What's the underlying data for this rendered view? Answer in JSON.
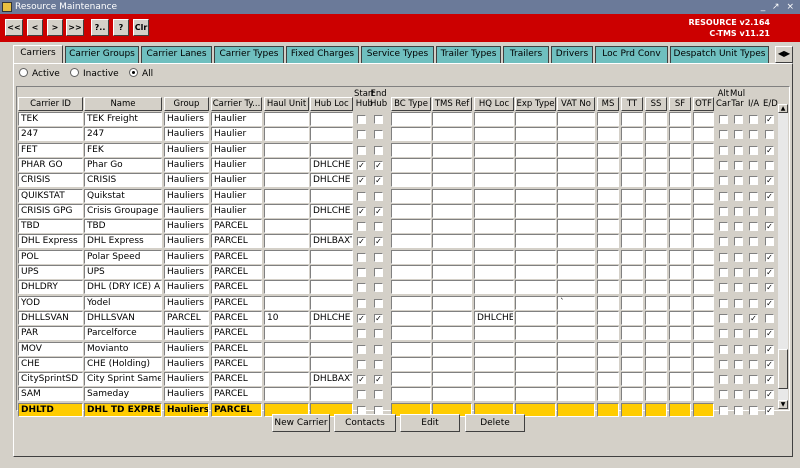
{
  "window": {
    "title": "Resource Maintenance",
    "controls": "_ ↗ ×"
  },
  "toolbar": {
    "buttons": [
      "<<",
      "<",
      ">",
      ">>",
      "?..",
      "?",
      "Clr"
    ]
  },
  "version": {
    "line1": "RESOURCE v2.164",
    "line2": "C-TMS v11.21"
  },
  "tabs": [
    "Carriers",
    "Carrier Groups",
    "Carrier Lanes",
    "Carrier Types",
    "Fixed Charges",
    "Service Types",
    "Trailer Types",
    "Trailers",
    "Drivers",
    "Loc Prd Conv",
    "Despatch Unit Types"
  ],
  "tab_scroll": "◀▶",
  "filter": {
    "options": [
      "Active",
      "Inactive",
      "All"
    ],
    "selected": "All"
  },
  "columns": {
    "carrier_id": "Carrier ID",
    "name": "Name",
    "group": "Group",
    "carrier_type": "Carrier Ty...",
    "haul_unit": "Haul Unit",
    "hub_loc": "Hub Loc",
    "start_hub": "Start\nHub",
    "end_hub": "End\nHub",
    "bc_type": "BC Type",
    "tms_ref": "TMS Ref",
    "hq_loc": "HQ Loc",
    "exp_type": "Exp Type",
    "vat_no": "VAT No",
    "ms": "MS",
    "tt": "TT",
    "ss": "SS",
    "sf": "SF",
    "otf": "OTF",
    "alt_car": "Alt\nCar",
    "mul_tar": "Mul\nTar",
    "ia": "I/A",
    "ed": "E/D"
  },
  "rows": [
    {
      "id": "TEK",
      "name": "TEK Freight",
      "group": "Hauliers",
      "type": "Haulier",
      "haul": "",
      "hub": "",
      "sh": false,
      "eh": false,
      "hq": "",
      "vat": "",
      "ed": true
    },
    {
      "id": "247",
      "name": "247",
      "group": "Hauliers",
      "type": "Haulier",
      "haul": "",
      "hub": "",
      "sh": false,
      "eh": false,
      "hq": "",
      "vat": "",
      "ed": false
    },
    {
      "id": "FET",
      "name": "FEK",
      "group": "Hauliers",
      "type": "Haulier",
      "haul": "",
      "hub": "",
      "sh": false,
      "eh": false,
      "hq": "",
      "vat": "",
      "ed": true
    },
    {
      "id": "PHAR GO",
      "name": "Phar Go",
      "group": "Hauliers",
      "type": "Haulier",
      "haul": "",
      "hub": "DHLCHE",
      "sh": true,
      "eh": true,
      "hq": "",
      "vat": "",
      "ed": false
    },
    {
      "id": "CRISIS",
      "name": "CRISIS",
      "group": "Hauliers",
      "type": "Haulier",
      "haul": "",
      "hub": "DHLCHE",
      "sh": true,
      "eh": true,
      "hq": "",
      "vat": "",
      "ed": true
    },
    {
      "id": "QUIKSTAT",
      "name": "Quikstat",
      "group": "Hauliers",
      "type": "Haulier",
      "haul": "",
      "hub": "",
      "sh": false,
      "eh": false,
      "hq": "",
      "vat": "",
      "ed": true
    },
    {
      "id": "CRISIS GPG",
      "name": "Crisis Groupage",
      "group": "Hauliers",
      "type": "Haulier",
      "haul": "",
      "hub": "DHLCHE",
      "sh": true,
      "eh": true,
      "hq": "",
      "vat": "",
      "ed": false
    },
    {
      "id": "TBD",
      "name": "TBD",
      "group": "Hauliers",
      "type": "PARCEL",
      "haul": "",
      "hub": "",
      "sh": false,
      "eh": false,
      "hq": "",
      "vat": "",
      "ed": true
    },
    {
      "id": "DHL Express",
      "name": "DHL Express",
      "group": "Hauliers",
      "type": "PARCEL",
      "haul": "",
      "hub": "DHLBAXT",
      "sh": true,
      "eh": true,
      "hq": "",
      "vat": "",
      "ed": false
    },
    {
      "id": "POL",
      "name": "Polar Speed",
      "group": "Hauliers",
      "type": "PARCEL",
      "haul": "",
      "hub": "",
      "sh": false,
      "eh": false,
      "hq": "",
      "vat": "",
      "ed": true
    },
    {
      "id": "UPS",
      "name": "UPS",
      "group": "Hauliers",
      "type": "PARCEL",
      "haul": "",
      "hub": "",
      "sh": false,
      "eh": false,
      "hq": "",
      "vat": "",
      "ed": true
    },
    {
      "id": "DHLDRY",
      "name": "DHL (DRY ICE) A",
      "group": "Hauliers",
      "type": "PARCEL",
      "haul": "",
      "hub": "",
      "sh": false,
      "eh": false,
      "hq": "",
      "vat": "",
      "ed": true
    },
    {
      "id": "YOD",
      "name": "Yodel",
      "group": "Hauliers",
      "type": "PARCEL",
      "haul": "",
      "hub": "",
      "sh": false,
      "eh": false,
      "hq": "",
      "vat": "`",
      "ed": true
    },
    {
      "id": "DHLLSVAN",
      "name": "DHLLSVAN",
      "group": "PARCEL",
      "type": "PARCEL",
      "haul": "10",
      "hub": "DHLCHE",
      "sh": true,
      "eh": true,
      "hq": "DHLCHE",
      "vat": "",
      "ed": false,
      "ia": true
    },
    {
      "id": "PAR",
      "name": "Parcelforce",
      "group": "Hauliers",
      "type": "PARCEL",
      "haul": "",
      "hub": "",
      "sh": false,
      "eh": false,
      "hq": "",
      "vat": "",
      "ed": true
    },
    {
      "id": "MOV",
      "name": "Movianto",
      "group": "Hauliers",
      "type": "PARCEL",
      "haul": "",
      "hub": "",
      "sh": false,
      "eh": false,
      "hq": "",
      "vat": "",
      "ed": true
    },
    {
      "id": "CHE",
      "name": "CHE (Holding)",
      "group": "Hauliers",
      "type": "PARCEL",
      "haul": "",
      "hub": "",
      "sh": false,
      "eh": false,
      "hq": "",
      "vat": "",
      "ed": true
    },
    {
      "id": "CitySprintSD",
      "name": "City Sprint SameD",
      "group": "Hauliers",
      "type": "PARCEL",
      "haul": "",
      "hub": "DHLBAXT",
      "sh": true,
      "eh": true,
      "hq": "",
      "vat": "",
      "ed": true
    },
    {
      "id": "SAM",
      "name": "Sameday",
      "group": "Hauliers",
      "type": "PARCEL",
      "haul": "",
      "hub": "",
      "sh": false,
      "eh": false,
      "hq": "",
      "vat": "",
      "ed": true
    },
    {
      "id": "DHLTD",
      "name": "DHL TD EXPRESS",
      "group": "Hauliers",
      "type": "PARCEL",
      "haul": "",
      "hub": "",
      "sh": false,
      "eh": false,
      "hq": "",
      "vat": "",
      "ed": true,
      "selected": true
    }
  ],
  "actions": [
    "New Carrier",
    "Contacts",
    "Edit",
    "Delete"
  ],
  "colors": {
    "titlebar": "#6b7a99",
    "redbar": "#cc0000",
    "tab": "#6fbfbf",
    "selected_row": "#ffcc00",
    "face": "#d4d0c8"
  }
}
